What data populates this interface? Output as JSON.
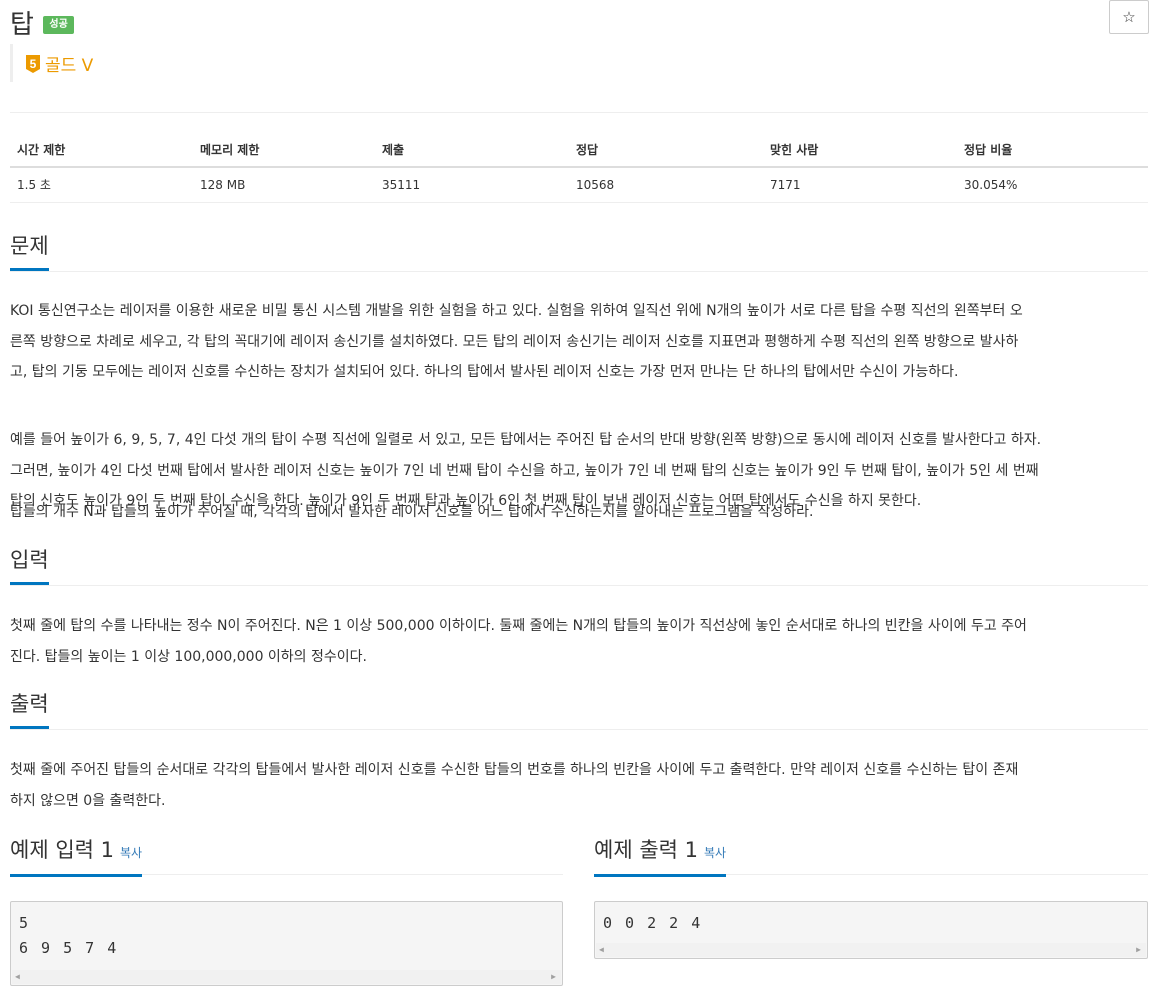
{
  "problem": {
    "title": "탑",
    "status_badge": "성공",
    "star_icon": "☆",
    "tier": {
      "level": "5",
      "label": "골드 V",
      "color": "#ec9a00"
    }
  },
  "info_table": {
    "headers": [
      "시간 제한",
      "메모리 제한",
      "제출",
      "정답",
      "맞힌 사람",
      "정답 비율"
    ],
    "values": [
      "1.5 초",
      "128 MB",
      "35111",
      "10568",
      "7171",
      "30.054%"
    ]
  },
  "sections": {
    "problem": {
      "heading": "문제",
      "paragraphs": [
        [
          "KOI 통신연구소는 레이저를 이용한 새로운 비밀 통신 시스템 개발을 위한 실험을 하고 있다. 실험을 위하여 일직선 위에 N개의 높이가 서로 다른 탑을 수평 직선의 왼쪽부터 오",
          "른쪽 방향으로 차례로 세우고, 각 탑의 꼭대기에 레이저 송신기를 설치하였다. 모든 탑의 레이저 송신기는 레이저 신호를 지표면과 평행하게 수평 직선의 왼쪽 방향으로 발사하",
          "고, 탑의 기둥 모두에는 레이저 신호를 수신하는 장치가 설치되어 있다. 하나의 탑에서 발사된 레이저 신호는 가장 먼저 만나는 단 하나의 탑에서만 수신이 가능하다."
        ],
        [
          "예를 들어 높이가 6, 9, 5, 7, 4인 다섯 개의 탑이 수평 직선에 일렬로 서 있고, 모든 탑에서는 주어진 탑 순서의 반대 방향(왼쪽 방향)으로 동시에 레이저 신호를 발사한다고 하자.",
          "그러면, 높이가 4인 다섯 번째 탑에서 발사한 레이저 신호는 높이가 7인 네 번째 탑이 수신을 하고, 높이가 7인 네 번째 탑의 신호는 높이가 9인 두 번째 탑이, 높이가 5인 세 번째",
          "탑의 신호도 높이가 9인 두 번째 탑이 수신을 한다. 높이가 9인 두 번째 탑과 높이가 6인 첫 번째 탑이 보낸 레이저 신호는 어떤 탑에서도 수신을 하지 못한다."
        ],
        [
          "탑들의 개수 N과 탑들의 높이가 주어질 때, 각각의 탑에서 발사한 레이저 신호를 어느 탑에서 수신하는지를 알아내는 프로그램을 작성하라."
        ]
      ]
    },
    "input": {
      "heading": "입력",
      "lines": [
        "첫째 줄에 탑의 수를 나타내는 정수 N이 주어진다. N은 1 이상 500,000 이하이다. 둘째 줄에는 N개의 탑들의 높이가 직선상에 놓인 순서대로 하나의 빈칸을 사이에 두고 주어",
        "진다. 탑들의 높이는 1 이상 100,000,000 이하의 정수이다."
      ]
    },
    "output": {
      "heading": "출력",
      "lines": [
        "첫째 줄에 주어진 탑들의 순서대로 각각의 탑들에서 발사한 레이저 신호를 수신한 탑들의 번호를 하나의 빈칸을 사이에 두고 출력한다. 만약 레이저 신호를 수신하는 탑이 존재",
        "하지 않으면 0을 출력한다."
      ]
    }
  },
  "samples": {
    "input": {
      "heading": "예제 입력 1",
      "copy_label": "복사",
      "lines": [
        "5",
        "6 9 5 7 4"
      ]
    },
    "output": {
      "heading": "예제 출력 1",
      "copy_label": "복사",
      "lines": [
        "0 0 2 2 4"
      ]
    },
    "scroll_left": "◀",
    "scroll_right": "▶"
  }
}
